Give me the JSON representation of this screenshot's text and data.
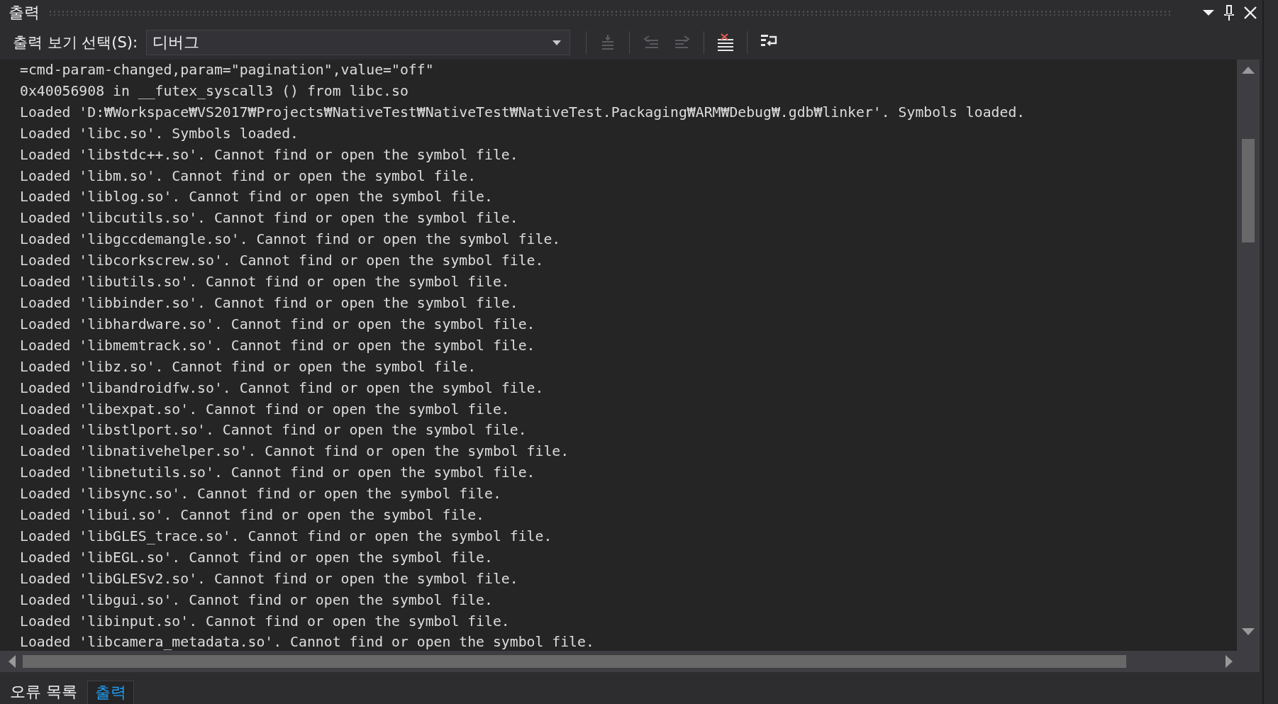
{
  "window": {
    "title": "출력"
  },
  "toolbar": {
    "label": "출력 보기 선택(S):",
    "source": {
      "value": "디버그"
    },
    "buttons": [
      {
        "kind": "goto",
        "disabled": true
      },
      {
        "kind": "prev",
        "disabled": true
      },
      {
        "kind": "next",
        "disabled": true
      },
      {
        "kind": "clear",
        "disabled": false
      },
      {
        "kind": "wrap",
        "disabled": false
      }
    ]
  },
  "output": {
    "lines": [
      "=cmd-param-changed,param=\"pagination\",value=\"off\"",
      "0x40056908 in __futex_syscall3 () from libc.so",
      "Loaded 'D:₩Workspace₩VS2017₩Projects₩NativeTest₩NativeTest₩NativeTest.Packaging₩ARM₩Debug₩.gdb₩linker'. Symbols loaded.",
      "Loaded 'libc.so'. Symbols loaded.",
      "Loaded 'libstdc++.so'. Cannot find or open the symbol file.",
      "Loaded 'libm.so'. Cannot find or open the symbol file.",
      "Loaded 'liblog.so'. Cannot find or open the symbol file.",
      "Loaded 'libcutils.so'. Cannot find or open the symbol file.",
      "Loaded 'libgccdemangle.so'. Cannot find or open the symbol file.",
      "Loaded 'libcorkscrew.so'. Cannot find or open the symbol file.",
      "Loaded 'libutils.so'. Cannot find or open the symbol file.",
      "Loaded 'libbinder.so'. Cannot find or open the symbol file.",
      "Loaded 'libhardware.so'. Cannot find or open the symbol file.",
      "Loaded 'libmemtrack.so'. Cannot find or open the symbol file.",
      "Loaded 'libz.so'. Cannot find or open the symbol file.",
      "Loaded 'libandroidfw.so'. Cannot find or open the symbol file.",
      "Loaded 'libexpat.so'. Cannot find or open the symbol file.",
      "Loaded 'libstlport.so'. Cannot find or open the symbol file.",
      "Loaded 'libnativehelper.so'. Cannot find or open the symbol file.",
      "Loaded 'libnetutils.so'. Cannot find or open the symbol file.",
      "Loaded 'libsync.so'. Cannot find or open the symbol file.",
      "Loaded 'libui.so'. Cannot find or open the symbol file.",
      "Loaded 'libGLES_trace.so'. Cannot find or open the symbol file.",
      "Loaded 'libEGL.so'. Cannot find or open the symbol file.",
      "Loaded 'libGLESv2.so'. Cannot find or open the symbol file.",
      "Loaded 'libgui.so'. Cannot find or open the symbol file.",
      "Loaded 'libinput.so'. Cannot find or open the symbol file.",
      "Loaded 'libcamera_metadata.so'. Cannot find or open the symbol file."
    ]
  },
  "tabs": [
    {
      "label": "오류 목록",
      "selected": false
    },
    {
      "label": "출력",
      "selected": true
    }
  ]
}
